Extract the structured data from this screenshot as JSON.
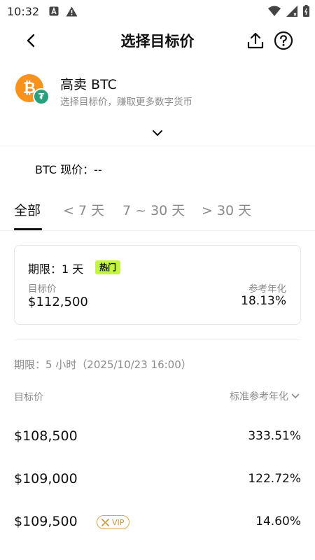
{
  "status_bar": {
    "time": "10:32"
  },
  "header": {
    "title": "选择目标价"
  },
  "product": {
    "title": "高卖 BTC",
    "subtitle": "选择目标价，赚取更多数字货币",
    "coin_symbol": "₿",
    "quote_symbol": "₮"
  },
  "current_price": "BTC 现价：--",
  "tabs": [
    {
      "label": "全部",
      "active": true
    },
    {
      "label": "< 7 天",
      "active": false
    },
    {
      "label": "7 ~ 30 天",
      "active": false
    },
    {
      "label": "> 30 天",
      "active": false
    }
  ],
  "featured": {
    "term": "期限：1 天",
    "badge": "热门",
    "target_label": "目标价",
    "rate_label": "参考年化",
    "target_value": "$112,500",
    "rate_value": "18.13%"
  },
  "section": {
    "term": "期限：5 小时（2025/10/23 16:00）",
    "col_left": "目标价",
    "col_right": "标准参考年化"
  },
  "rows": [
    {
      "price": "$108,500",
      "rate": "333.51%"
    },
    {
      "price": "$109,000",
      "rate": "122.72%"
    },
    {
      "price": "$109,500",
      "rate": "14.60%",
      "vip": "VIP"
    }
  ],
  "colors": {
    "accent_badge": "#c3f53c",
    "vip_gold": "#d9a74a",
    "btc": "#F7931A",
    "usdt": "#26A17B"
  }
}
